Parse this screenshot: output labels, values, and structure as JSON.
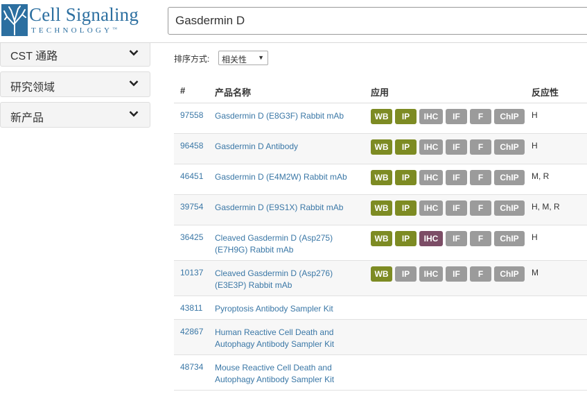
{
  "brand": {
    "name_line1": "Cell Signaling",
    "name_line2": "TECHNOLOGY",
    "tm": "™",
    "color": "#2c6fa0"
  },
  "search": {
    "value": "Gasdermin D",
    "placeholder": ""
  },
  "sidebar": {
    "items": [
      {
        "label": "CST 通路"
      },
      {
        "label": "研究领域"
      },
      {
        "label": "新产品"
      }
    ]
  },
  "sort": {
    "label": "排序方式:",
    "selected": "相关性"
  },
  "table": {
    "headers": {
      "num": "#",
      "name": "产品名称",
      "apps": "应用",
      "reactivity": "反应性"
    },
    "app_labels": [
      "WB",
      "IP",
      "IHC",
      "IF",
      "F",
      "ChIP"
    ],
    "colors": {
      "active": "#7d8b23",
      "inactive": "#9b9b9b",
      "ihc_active": "#7c4d66",
      "link": "#3a77a6"
    },
    "rows": [
      {
        "num": "97558",
        "name": "Gasdermin D (E8G3F) Rabbit mAb",
        "apps": [
          "green",
          "green",
          "gray",
          "gray",
          "gray",
          "gray"
        ],
        "reactivity": "H"
      },
      {
        "num": "96458",
        "name": "Gasdermin D Antibody",
        "apps": [
          "green",
          "green",
          "gray",
          "gray",
          "gray",
          "gray"
        ],
        "reactivity": "H"
      },
      {
        "num": "46451",
        "name": "Gasdermin D (E4M2W) Rabbit mAb",
        "apps": [
          "green",
          "green",
          "gray",
          "gray",
          "gray",
          "gray"
        ],
        "reactivity": "M, R"
      },
      {
        "num": "39754",
        "name": "Gasdermin D (E9S1X) Rabbit mAb",
        "apps": [
          "green",
          "green",
          "gray",
          "gray",
          "gray",
          "gray"
        ],
        "reactivity": "H, M, R"
      },
      {
        "num": "36425",
        "name": "Cleaved Gasdermin D (Asp275) (E7H9G) Rabbit mAb",
        "apps": [
          "green",
          "green",
          "purple",
          "gray",
          "gray",
          "gray"
        ],
        "reactivity": "H"
      },
      {
        "num": "10137",
        "name": "Cleaved Gasdermin D (Asp276) (E3E3P) Rabbit mAb",
        "apps": [
          "green",
          "gray",
          "gray",
          "gray",
          "gray",
          "gray"
        ],
        "reactivity": "M"
      },
      {
        "num": "43811",
        "name": "Pyroptosis Antibody Sampler Kit",
        "apps": [],
        "reactivity": ""
      },
      {
        "num": "42867",
        "name": "Human Reactive Cell Death and Autophagy Antibody Sampler Kit",
        "apps": [],
        "reactivity": ""
      },
      {
        "num": "48734",
        "name": "Mouse Reactive Cell Death and Autophagy Antibody Sampler Kit",
        "apps": [],
        "reactivity": ""
      }
    ]
  }
}
